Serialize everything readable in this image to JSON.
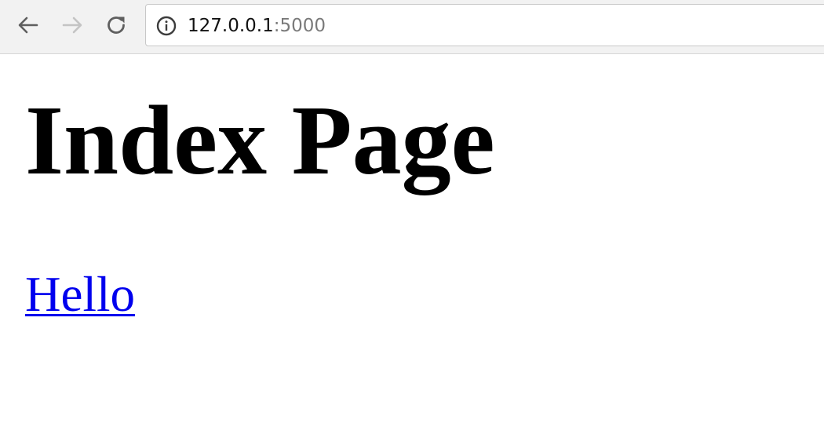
{
  "browser": {
    "url_host": "127.0.0.1",
    "url_port": ":5000",
    "icons": {
      "back": "back-arrow-icon",
      "forward": "forward-arrow-icon",
      "reload": "reload-icon",
      "site_info": "info-icon"
    },
    "forward_enabled": false
  },
  "page": {
    "title": "Index Page",
    "link_label": "Hello",
    "link_color": "#0000ee"
  }
}
